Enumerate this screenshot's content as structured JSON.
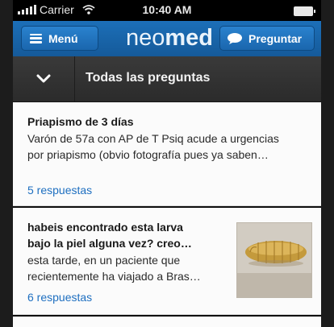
{
  "status_bar": {
    "carrier": "Carrier",
    "time": "10:40 AM"
  },
  "header": {
    "menu_label": "Menú",
    "logo_light": "neo",
    "logo_bold": "med",
    "ask_label": "Preguntar"
  },
  "filter": {
    "label": "Todas las preguntas"
  },
  "questions": [
    {
      "title": "Priapismo de 3 días",
      "body_line1": "Varón de 57a con AP de T Psiq acude a urgencias",
      "body_line2": "por priapismo (obvio fotografía pues ya saben…",
      "answers": "5 respuestas"
    },
    {
      "title_line1": "habeis encontrado esta larva",
      "title_line2": "bajo la piel alguna vez? creo…",
      "body_line1": "esta tarde, en un paciente que",
      "body_line2": "recientemente ha viajado a Bras…",
      "answers": "6 respuestas",
      "thumbnail": "larva-photo"
    }
  ],
  "colors": {
    "header_blue": "#1a66ad",
    "link_blue": "#1e6fc0",
    "filter_dark": "#2f2f2f"
  }
}
